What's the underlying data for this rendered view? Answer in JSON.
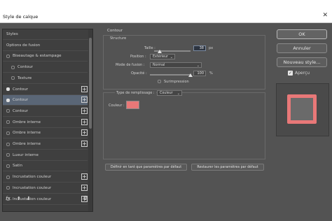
{
  "window": {
    "title": "Style de calque",
    "close": "✕"
  },
  "styles_panel": {
    "items": [
      {
        "label": "Styles",
        "checkbox": false,
        "checked": false,
        "plus": false,
        "selected": false,
        "indent": 0
      },
      {
        "label": "Options de fusion",
        "checkbox": false,
        "checked": false,
        "plus": false,
        "selected": false,
        "indent": 0
      },
      {
        "label": "Biseautage & estampage",
        "checkbox": true,
        "checked": false,
        "plus": false,
        "selected": false,
        "indent": 0
      },
      {
        "label": "Contour",
        "checkbox": true,
        "checked": false,
        "plus": false,
        "selected": false,
        "indent": 1
      },
      {
        "label": "Texture",
        "checkbox": true,
        "checked": false,
        "plus": false,
        "selected": false,
        "indent": 1
      },
      {
        "label": "Contour",
        "checkbox": true,
        "checked": true,
        "plus": true,
        "selected": false,
        "indent": 0
      },
      {
        "label": "Contour",
        "checkbox": true,
        "checked": true,
        "plus": true,
        "selected": true,
        "indent": 0
      },
      {
        "label": "Contour",
        "checkbox": true,
        "checked": false,
        "plus": true,
        "selected": false,
        "indent": 0
      },
      {
        "label": "Ombre interne",
        "checkbox": true,
        "checked": false,
        "plus": true,
        "selected": false,
        "indent": 0
      },
      {
        "label": "Ombre interne",
        "checkbox": true,
        "checked": false,
        "plus": true,
        "selected": false,
        "indent": 0
      },
      {
        "label": "Ombre interne",
        "checkbox": true,
        "checked": false,
        "plus": true,
        "selected": false,
        "indent": 0
      },
      {
        "label": "Lueur interne",
        "checkbox": true,
        "checked": false,
        "plus": false,
        "selected": false,
        "indent": 0
      },
      {
        "label": "Satin",
        "checkbox": true,
        "checked": false,
        "plus": false,
        "selected": false,
        "indent": 0
      },
      {
        "label": "Incrustation couleur",
        "checkbox": true,
        "checked": false,
        "plus": true,
        "selected": false,
        "indent": 0
      },
      {
        "label": "Incrustation couleur",
        "checkbox": true,
        "checked": false,
        "plus": true,
        "selected": false,
        "indent": 0
      },
      {
        "label": "Incrustation couleur",
        "checkbox": true,
        "checked": false,
        "plus": true,
        "selected": false,
        "indent": 0
      }
    ],
    "footer": {
      "fx": "fx.",
      "up": "⬆",
      "down": "⬇",
      "trash": "🗑"
    }
  },
  "contour": {
    "title": "Contour",
    "structure": {
      "title": "Structure",
      "taille_label": "Taille :",
      "taille_value": "38",
      "taille_unit": "px",
      "taille_fraction": 0.15,
      "position_label": "Position :",
      "position_value": "Extérieur",
      "mode_label": "Mode de fusion :",
      "mode_value": "Normal",
      "opacite_label": "Opacité :",
      "opacite_value": "100",
      "opacite_unit": "%",
      "opacite_fraction": 1.0,
      "surimpression_label": "Surimpression",
      "surimpression_checked": false
    },
    "fill": {
      "type_label": "Type de remplissage :",
      "type_value": "Couleur",
      "couleur_label": "Couleur :",
      "couleur_hex": "#e87878"
    },
    "buttons": {
      "default_set": "Définir en tant que paramètres par défaut",
      "default_reset": "Restaurer les paramètres par défaut"
    }
  },
  "right": {
    "ok": "OK",
    "cancel": "Annuler",
    "new_style": "Nouveau style...",
    "apercu_label": "Aperçu",
    "apercu_checked": true,
    "preview_stroke_hex": "#e87878"
  }
}
